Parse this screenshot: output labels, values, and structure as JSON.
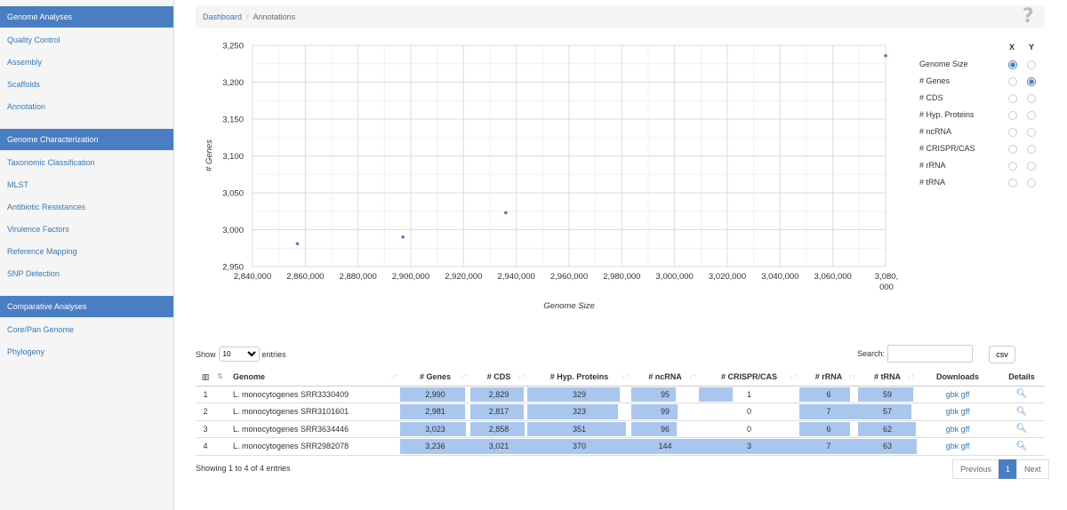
{
  "sidebar": {
    "sections": [
      {
        "title": "Genome Analyses",
        "items": [
          "Quality Control",
          "Assembly",
          "Scaffolds",
          "Annotation"
        ]
      },
      {
        "title": "Genome Characterization",
        "items": [
          "Taxonomic Classification",
          "MLST",
          "Antibiotic Resistances",
          "Virulence Factors",
          "Reference Mapping",
          "SNP Detection"
        ]
      },
      {
        "title": "Comparative Analyses",
        "items": [
          "Core/Pan Genome",
          "Phylogeny"
        ]
      }
    ]
  },
  "breadcrumb": {
    "home": "Dashboard",
    "separator": "/",
    "current": "Annotations"
  },
  "help_icon": "?",
  "axis_selector": {
    "x_header": "X",
    "y_header": "Y",
    "options": [
      {
        "label": "Genome Size",
        "x": true,
        "y": false
      },
      {
        "label": "# Genes",
        "x": false,
        "y": true
      },
      {
        "label": "# CDS",
        "x": false,
        "y": false
      },
      {
        "label": "# Hyp. Proteins",
        "x": false,
        "y": false
      },
      {
        "label": "# ncRNA",
        "x": false,
        "y": false
      },
      {
        "label": "# CRISPR/CAS",
        "x": false,
        "y": false
      },
      {
        "label": "# rRNA",
        "x": false,
        "y": false
      },
      {
        "label": "# tRNA",
        "x": false,
        "y": false
      }
    ]
  },
  "chart_data": {
    "type": "scatter",
    "xlabel": "Genome Size",
    "ylabel": "# Genes",
    "xlim": [
      2840000,
      3080000
    ],
    "ylim": [
      2950,
      3250
    ],
    "xticks": [
      2840000,
      2860000,
      2880000,
      2900000,
      2920000,
      2940000,
      2960000,
      2980000,
      3000000,
      3020000,
      3040000,
      3060000,
      3080000
    ],
    "xtick_labels": [
      "2,840,000",
      "2,860,000",
      "2,880,000",
      "2,900,000",
      "2,920,000",
      "2,940,000",
      "2,960,000",
      "2,980,000",
      "3,000,000",
      "3,020,000",
      "3,040,000",
      "3,060,000",
      "3,080,\n000"
    ],
    "yticks": [
      2950,
      3000,
      3050,
      3100,
      3150,
      3200,
      3250
    ],
    "ytick_labels": [
      "2,950",
      "3,000",
      "3,050",
      "3,100",
      "3,150",
      "3,200",
      "3,250"
    ],
    "grid": true,
    "point_color": "#4a7ec2",
    "points": [
      {
        "x": 2857000,
        "y": 2981
      },
      {
        "x": 2897000,
        "y": 2990
      },
      {
        "x": 2936000,
        "y": 3023
      },
      {
        "x": 3080000,
        "y": 3236
      }
    ]
  },
  "table_controls": {
    "show_label": "Show",
    "entries_label": "entries",
    "page_length": "10",
    "search_label": "Search:",
    "search_value": "",
    "csv_label": "csv"
  },
  "table": {
    "columns": [
      "",
      "Genome",
      "# Genes",
      "# CDS",
      "# Hyp. Proteins",
      "# ncRNA",
      "# CRISPR/CAS",
      "# rRNA",
      "# tRNA",
      "Downloads",
      "Details"
    ],
    "rows": [
      {
        "idx": "1",
        "genome": "L. monocytogenes SRR3330409",
        "genes": "2,990",
        "cds": "2,829",
        "hyp": "329",
        "ncrna": "95",
        "crispr": "1",
        "rrna": "6",
        "trna": "59",
        "gbk": "gbk",
        "gff": "gff"
      },
      {
        "idx": "2",
        "genome": "L. monocytogenes SRR3101601",
        "genes": "2,981",
        "cds": "2,817",
        "hyp": "323",
        "ncrna": "99",
        "crispr": "0",
        "rrna": "7",
        "trna": "57",
        "gbk": "gbk",
        "gff": "gff"
      },
      {
        "idx": "3",
        "genome": "L. monocytogenes SRR3634446",
        "genes": "3,023",
        "cds": "2,858",
        "hyp": "351",
        "ncrna": "96",
        "crispr": "0",
        "rrna": "6",
        "trna": "62",
        "gbk": "gbk",
        "gff": "gff"
      },
      {
        "idx": "4",
        "genome": "L. monocytogenes SRR2982078",
        "genes": "3,236",
        "cds": "3,021",
        "hyp": "370",
        "ncrna": "144",
        "crispr": "3",
        "rrna": "7",
        "trna": "63",
        "gbk": "gbk",
        "gff": "gff"
      }
    ],
    "bar_fraction": {
      "genes": [
        0.924,
        0.921,
        0.934,
        1.0
      ],
      "cds": [
        0.936,
        0.932,
        0.946,
        1.0
      ],
      "hyp": [
        0.889,
        0.873,
        0.949,
        1.0
      ],
      "ncrna": [
        0.66,
        0.688,
        0.667,
        1.0
      ],
      "crispr": [
        0.333,
        0.0,
        0.0,
        1.0
      ],
      "rrna": [
        0.857,
        1.0,
        0.857,
        1.0
      ],
      "trna": [
        0.937,
        0.905,
        0.984,
        1.0
      ]
    }
  },
  "footer": {
    "info": "Showing 1 to 4 of 4 entries",
    "prev": "Previous",
    "page": "1",
    "next": "Next"
  }
}
